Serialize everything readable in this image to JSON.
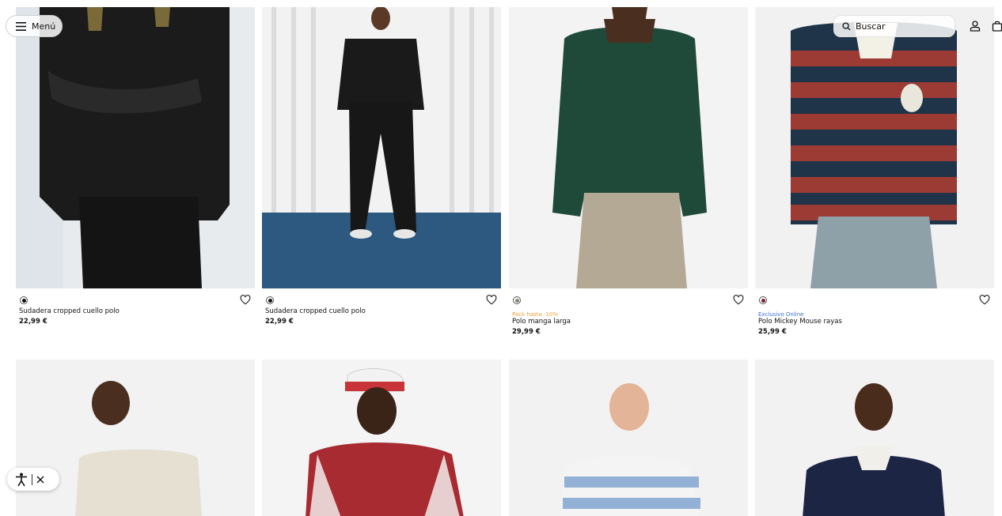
{
  "header": {
    "menu_label": "Menú",
    "search_placeholder": "Buscar"
  },
  "products": [
    {
      "name": "Sudadera cropped cuello polo",
      "price": "22,99 €",
      "tag": "",
      "swatch": "#111111"
    },
    {
      "name": "Sudadera cropped cuello polo",
      "price": "22,99 €",
      "tag": "",
      "swatch": "#111111"
    },
    {
      "name": "Polo manga larga",
      "price": "29,99 €",
      "tag": "Pack hasta -10%",
      "tag_color": "#e8a13a",
      "swatch": "#7f8a6f"
    },
    {
      "name": "Polo Mickey Mouse rayas",
      "price": "25,99 €",
      "tag": "Exclusivo Online",
      "tag_color": "#3a6fd6",
      "swatch": "#7a2134"
    }
  ],
  "row2_products": [
    {
      "image": "cream-polo-model"
    },
    {
      "image": "red-polo-cap-model"
    },
    {
      "image": "blue-stripe-polo-model"
    },
    {
      "image": "navy-rugby-polo-model"
    }
  ]
}
